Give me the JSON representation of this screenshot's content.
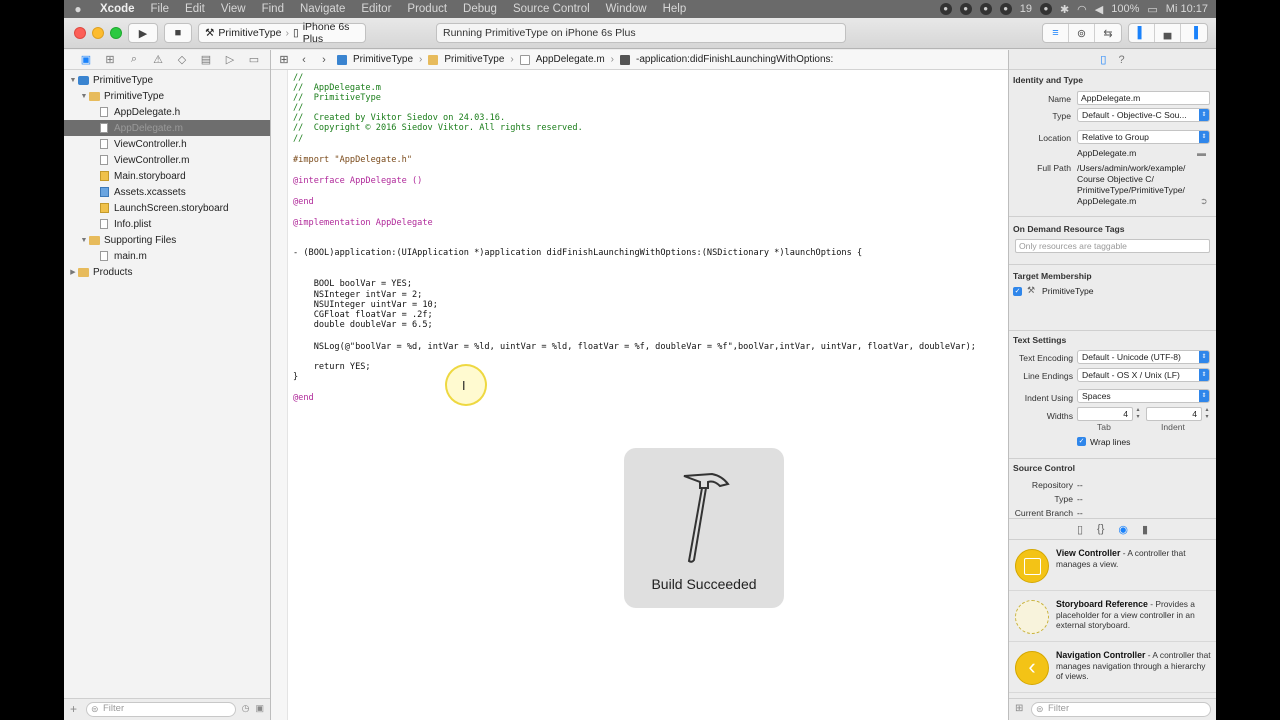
{
  "menubar": {
    "apple": "",
    "items": [
      "Xcode",
      "File",
      "Edit",
      "View",
      "Find",
      "Navigate",
      "Editor",
      "Product",
      "Debug",
      "Source Control",
      "Window",
      "Help"
    ],
    "status_battery": "100%",
    "status_badge": "19",
    "status_time": "Mi 10:17"
  },
  "toolbar": {
    "scheme_target": "PrimitiveType",
    "scheme_device": "iPhone 6s Plus",
    "activity_text": "Running PrimitiveType on iPhone 6s Plus"
  },
  "navigator": {
    "items": [
      {
        "label": "PrimitiveType",
        "type": "proj",
        "disclosure": "▼"
      },
      {
        "label": "PrimitiveType",
        "type": "folder",
        "disclosure": "▼"
      },
      {
        "label": "AppDelegate.h",
        "type": "file",
        "disclosure": ""
      },
      {
        "label": "AppDelegate.m",
        "type": "file",
        "disclosure": ""
      },
      {
        "label": "ViewController.h",
        "type": "file",
        "disclosure": ""
      },
      {
        "label": "ViewController.m",
        "type": "file",
        "disclosure": ""
      },
      {
        "label": "Main.storyboard",
        "type": "story",
        "disclosure": ""
      },
      {
        "label": "Assets.xcassets",
        "type": "assets",
        "disclosure": ""
      },
      {
        "label": "LaunchScreen.storyboard",
        "type": "story",
        "disclosure": ""
      },
      {
        "label": "Info.plist",
        "type": "file",
        "disclosure": ""
      },
      {
        "label": "Supporting Files",
        "type": "folder",
        "disclosure": "▼"
      },
      {
        "label": "main.m",
        "type": "file",
        "disclosure": ""
      },
      {
        "label": "Products",
        "type": "folder",
        "disclosure": "▶"
      }
    ],
    "filter_placeholder": "Filter"
  },
  "jumpbar": {
    "crumbs": [
      "PrimitiveType",
      "PrimitiveType",
      "AppDelegate.m",
      "-application:didFinishLaunchingWithOptions:"
    ]
  },
  "code_lines": [
    "//",
    "//  AppDelegate.m",
    "//  PrimitiveType",
    "//",
    "//  Created by Viktor Siedov on 24.03.16.",
    "//  Copyright © 2016 Siedov Viktor. All rights reserved.",
    "//",
    "#import \"AppDelegate.h\"",
    "@interface AppDelegate ()",
    "@end",
    "@implementation AppDelegate",
    "- (BOOL)application:(UIApplication *)application didFinishLaunchingWithOptions:(NSDictionary *)launchOptions {",
    "    BOOL boolVar = YES;",
    "    NSInteger intVar = 2;",
    "    NSUInteger uintVar = 10;",
    "    CGFloat floatVar = .2f;",
    "    double doubleVar = 6.5;",
    "    NSLog(@\"boolVar = %d, intVar = %ld, uintVar = %ld, floatVar = %f, doubleVar = %f\",boolVar,intVar, uintVar, floatVar, doubleVar);",
    "    return YES;",
    "}",
    "@end"
  ],
  "hud": {
    "label": "Build Succeeded"
  },
  "inspector": {
    "identity_title": "Identity and Type",
    "name_label": "Name",
    "name_value": "AppDelegate.m",
    "type_label": "Type",
    "type_value": "Default - Objective-C Sou...",
    "location_label": "Location",
    "location_value": "Relative to Group",
    "location_file": "AppDelegate.m",
    "fullpath_label": "Full Path",
    "fullpath_lines": [
      "/Users/admin/work/example/",
      "Course Objective C/",
      "PrimitiveType/PrimitiveType/",
      "AppDelegate.m"
    ],
    "ondemand_title": "On Demand Resource Tags",
    "ondemand_placeholder": "Only resources are taggable",
    "target_title": "Target Membership",
    "target_item": "PrimitiveType",
    "text_title": "Text Settings",
    "encoding_label": "Text Encoding",
    "encoding_value": "Default - Unicode (UTF-8)",
    "endings_label": "Line Endings",
    "endings_value": "Default - OS X / Unix (LF)",
    "indent_label": "Indent Using",
    "indent_value": "Spaces",
    "widths_label": "Widths",
    "tab_value": "4",
    "indent_width_value": "4",
    "tab_caption": "Tab",
    "indent_caption": "Indent",
    "wrap_label": "Wrap lines",
    "source_title": "Source Control",
    "repo_label": "Repository",
    "repo_value": "--",
    "sc_type_label": "Type",
    "sc_type_value": "--",
    "branch_label": "Current Branch",
    "branch_value": "--"
  },
  "library": {
    "items": [
      {
        "title": "View Controller",
        "desc": " - A controller that manages a view."
      },
      {
        "title": "Storyboard Reference",
        "desc": " - Provides a placeholder for a view controller in an external storyboard."
      },
      {
        "title": "Navigation Controller",
        "desc": " - A controller that manages navigation through a hierarchy of views."
      }
    ],
    "filter_placeholder": "Filter"
  }
}
